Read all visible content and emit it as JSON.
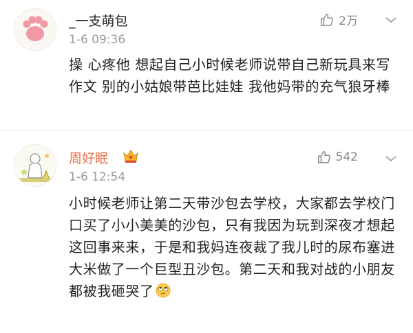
{
  "comments": [
    {
      "username": "_一支萌包",
      "time": "1-6 09:36",
      "likes": "2万",
      "text": "操 心疼他 想起自己小时候老师说带自己新玩具来写作文 别的小姑娘带芭比娃娃 我他妈带的充气狼牙棒",
      "username_color": "#222222"
    },
    {
      "username": "周好眠",
      "time": "1-6 12:54",
      "likes": "542",
      "text": "小时候老师让第二天带沙包去学校，大家都去学校门口买了小小美美的沙包，只有我因为玩到深夜才想起这回事来来，于是和我妈连夜裁了我儿时的尿布塞进大米做了一个巨型丑沙包。第二天和我对战的小朋友都被我砸哭了",
      "username_color": "#eb7350",
      "badge_icon": "crown-icon",
      "emoji_icon": "eye-roll-emoji-icon"
    }
  ],
  "icons": {
    "like": "thumb-up-icon",
    "more": "chevron-down-icon"
  }
}
